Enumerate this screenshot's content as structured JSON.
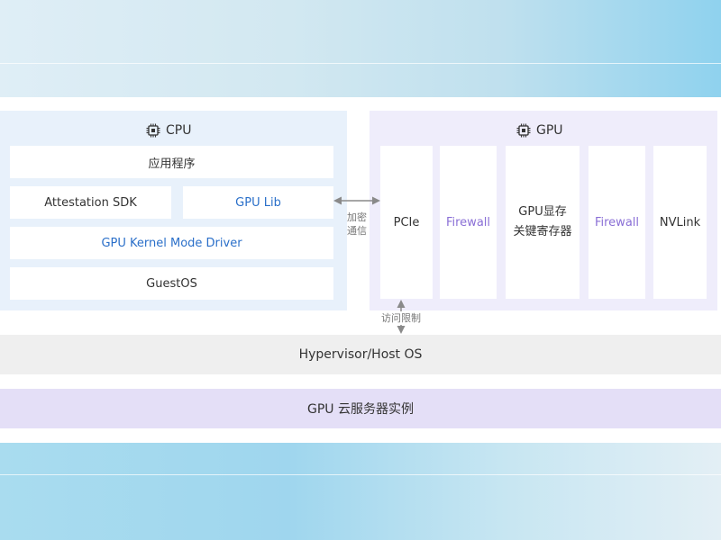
{
  "cpu": {
    "title": "CPU",
    "app_label": "应用程序",
    "attestation_label": "Attestation SDK",
    "gpu_lib_label": "GPU Lib",
    "driver_label": "GPU Kernel Mode Driver",
    "guest_os_label": "GuestOS"
  },
  "gpu": {
    "title": "GPU",
    "pcie_label": "PCIe",
    "firewall_left_label": "Firewall",
    "memory_line1": "GPU显存",
    "memory_line2": "关键寄存器",
    "firewall_right_label": "Firewall",
    "nvlink_label": "NVLink"
  },
  "connections": {
    "encrypted_line1": "加密",
    "encrypted_line2": "通信",
    "access_limit": "访问限制"
  },
  "layers": {
    "hypervisor_label": "Hypervisor/Host OS",
    "cloud_instance_label": "GPU 云服务器实例"
  },
  "colors": {
    "blue_text": "#2a6fc9",
    "purple_text": "#8a6fd6",
    "cpu_area_bg": "#e8f1fb",
    "gpu_area_bg": "#efedfb",
    "cloud_bar_bg": "#e4dff7"
  }
}
